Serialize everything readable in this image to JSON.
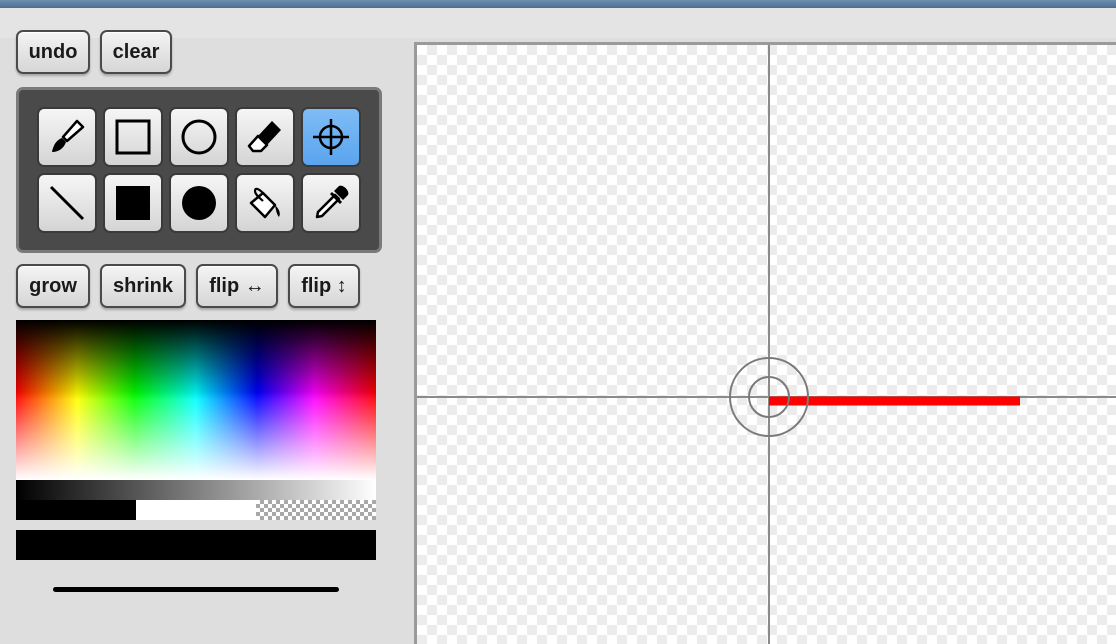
{
  "toolbar": {
    "undo_label": "undo",
    "clear_label": "clear"
  },
  "tools": [
    {
      "name": "brush",
      "icon": "paintbrush-icon",
      "active": false
    },
    {
      "name": "rectangle",
      "icon": "rectangle-outline-icon",
      "active": false
    },
    {
      "name": "circle",
      "icon": "circle-outline-icon",
      "active": false
    },
    {
      "name": "eraser",
      "icon": "eraser-icon",
      "active": false
    },
    {
      "name": "crosshair",
      "icon": "crosshair-icon",
      "active": true
    },
    {
      "name": "line",
      "icon": "line-icon",
      "active": false
    },
    {
      "name": "filled-rectangle",
      "icon": "filled-rectangle-icon",
      "active": false
    },
    {
      "name": "filled-circle",
      "icon": "filled-circle-icon",
      "active": false
    },
    {
      "name": "fill-bucket",
      "icon": "paint-bucket-icon",
      "active": false
    },
    {
      "name": "eyedropper",
      "icon": "eyedropper-icon",
      "active": false
    }
  ],
  "transform": {
    "grow_label": "grow",
    "shrink_label": "shrink",
    "flip_h_label": "flip ↔",
    "flip_v_label": "flip ↕"
  },
  "colors": {
    "current": "#000000",
    "swatches": [
      "#000000",
      "#ffffff",
      "transparent"
    ],
    "active_tool_highlight": "#6aaef2",
    "stroke_on_canvas": "#ff0000"
  }
}
